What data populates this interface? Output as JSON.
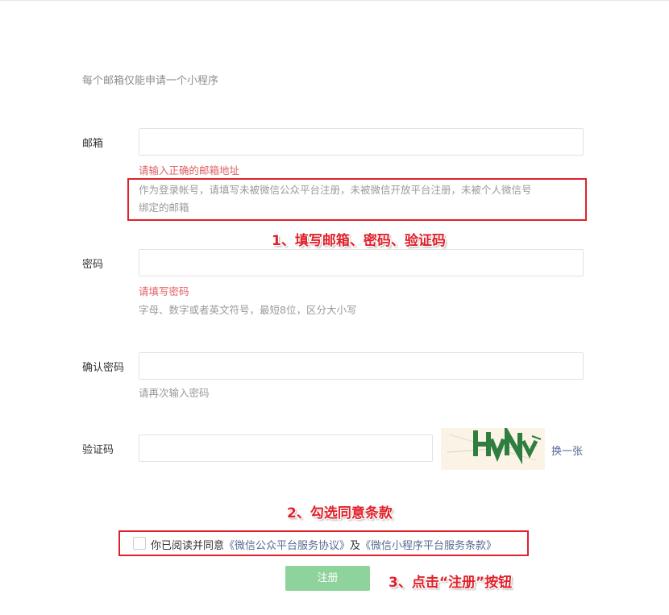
{
  "intro": "每个邮箱仅能申请一个小程序",
  "email": {
    "label": "邮箱",
    "value": "",
    "placeholder": "",
    "error": "请输入正确的邮箱地址",
    "tip_line1": "作为登录帐号，请填写未被微信公众平台注册，未被微信开放平台注册，未被个人微信号",
    "tip_line2": "绑定的邮箱"
  },
  "password": {
    "label": "密码",
    "value": "",
    "placeholder": "",
    "error": "请填写密码",
    "tip": "字母、数字或者英文符号，最短8位，区分大小写"
  },
  "confirm_password": {
    "label": "确认密码",
    "value": "",
    "placeholder": "",
    "tip": "请再次输入密码"
  },
  "captcha": {
    "label": "验证码",
    "value": "",
    "placeholder": "",
    "image_text": "HvNv",
    "refresh_label": "换一张"
  },
  "agreement": {
    "checked": false,
    "prefix": "你已阅读并同意",
    "link1": "《微信公众平台服务协议》",
    "conj": "及",
    "link2": "《微信小程序平台服务条款》"
  },
  "submit_label": "注册",
  "annotations": {
    "step1": "1、填写邮箱、密码、验证码",
    "step2": "2、勾选同意条款",
    "step3": "3、点击“注册”按钮"
  },
  "colors": {
    "annotation_red": "#e0212b",
    "error_red": "#e15f63",
    "link_blue": "#576b95",
    "button_green_disabled": "#8fd39c"
  }
}
